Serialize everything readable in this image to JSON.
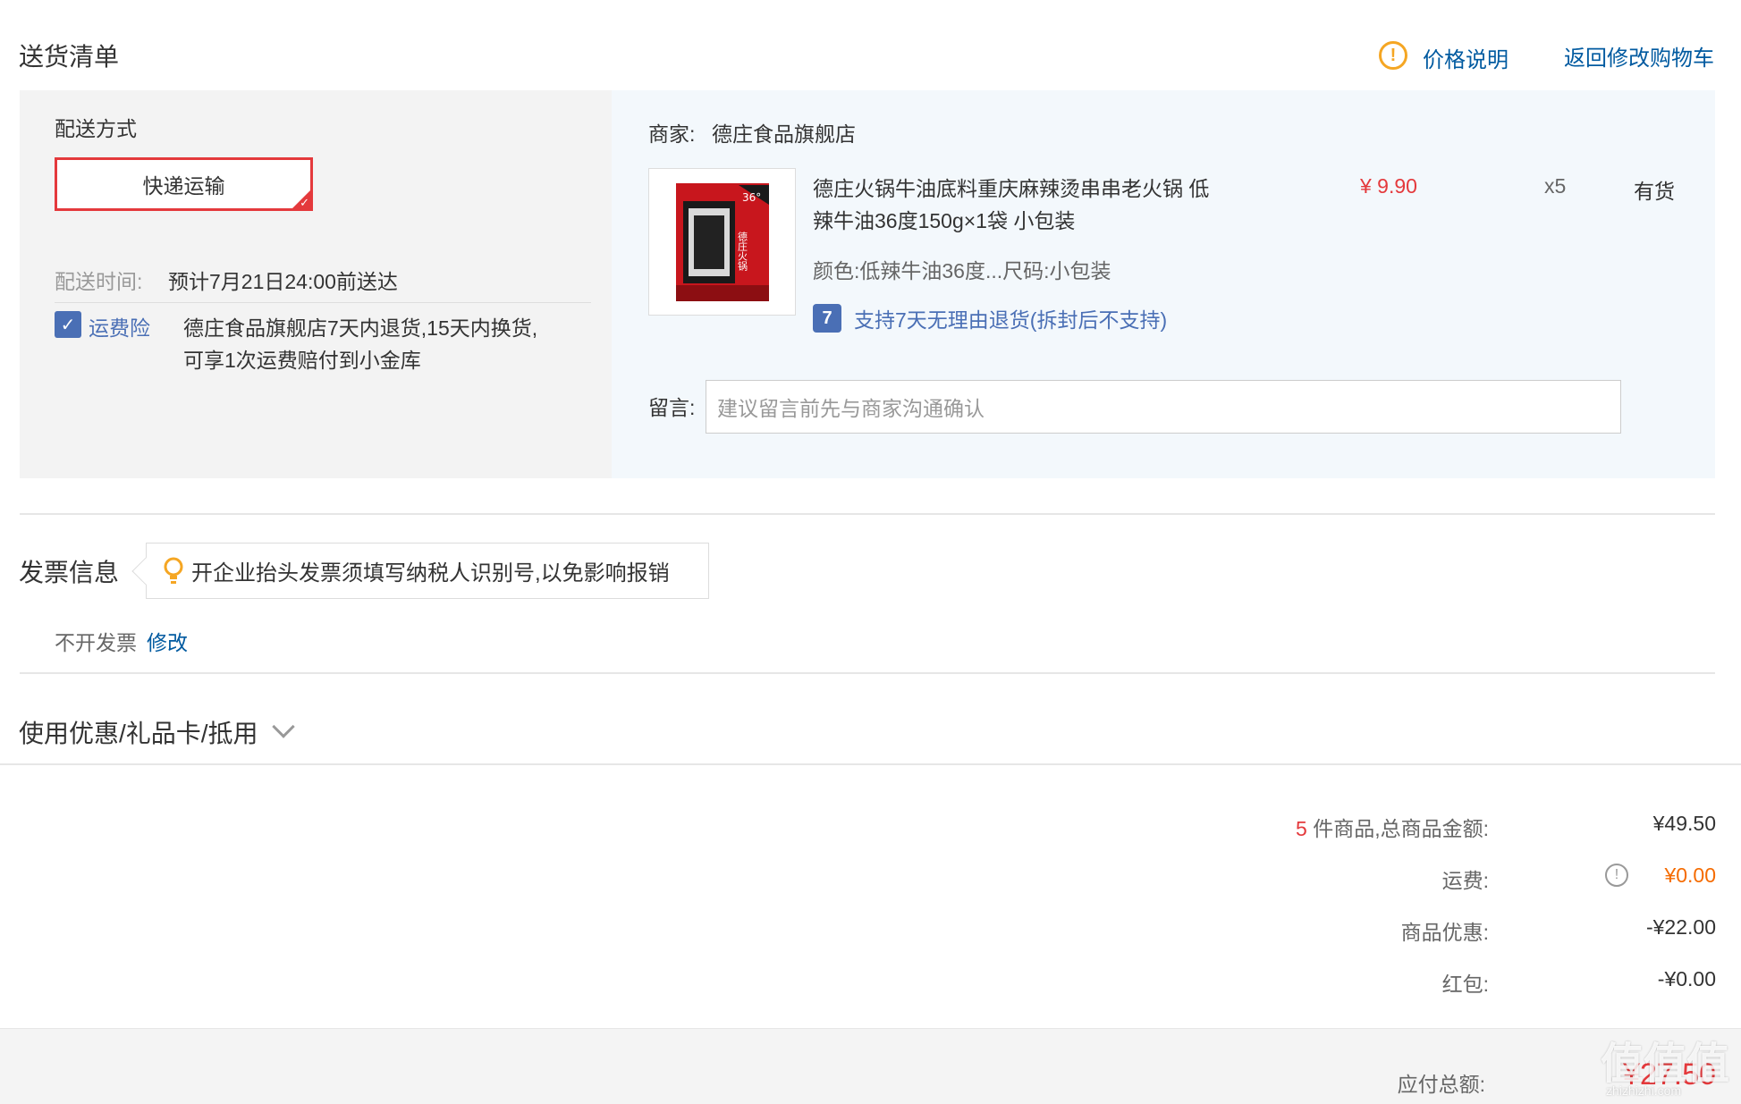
{
  "delivery": {
    "title": "送货清单",
    "price_note": "价格说明",
    "back_to_cart": "返回修改购物车",
    "method_label": "配送方式",
    "method_value": "快递运输",
    "time_label": "配送时间:",
    "time_value": "预计7月21日24:00前送达",
    "insurance_label": "运费险",
    "insurance_text_line1": "德庄食品旗舰店7天内退货,15天内换货,",
    "insurance_text_line2": "可享1次运费赔付到小金库"
  },
  "shop": {
    "label": "商家:",
    "name": "德庄食品旗舰店",
    "product": {
      "title_line1": "德庄火锅牛油底料重庆麻辣烫串串老火锅 低",
      "title_line2": "辣牛油36度150g×1袋 小包装",
      "price": "¥ 9.90",
      "qty": "x5",
      "stock": "有货",
      "spec": "颜色:低辣牛油36度...尺码:小包装",
      "return_badge": "7",
      "return_policy": "支持7天无理由退货(拆封后不支持)",
      "image_label_1": "36°",
      "image_label_2": "德庄火锅"
    },
    "note_label": "留言:",
    "note_placeholder": "建议留言前先与商家沟通确认"
  },
  "invoice": {
    "title": "发票信息",
    "tip": "开企业抬头发票须填写纳税人识别号,以免影响报销",
    "status": "不开发票",
    "edit": "修改"
  },
  "coupon": {
    "title": "使用优惠/礼品卡/抵用"
  },
  "summary": {
    "count": "5",
    "goods_label": "件商品,总商品金额:",
    "goods_value": "¥49.50",
    "shipping_label": "运费:",
    "shipping_value": "¥0.00",
    "discount_label": "商品优惠:",
    "discount_value": "-¥22.00",
    "redpack_label": "红包:",
    "redpack_value": "-¥0.00",
    "total_label": "应付总额:",
    "total_value": "¥27.50"
  },
  "watermark": {
    "text": "值值值",
    "sub": "zhizhizhi.com"
  },
  "colors": {
    "accent_red": "#e4393c",
    "link_blue": "#005aa0",
    "warn_orange": "#f5a623",
    "shipping_orange": "#f56b00"
  }
}
